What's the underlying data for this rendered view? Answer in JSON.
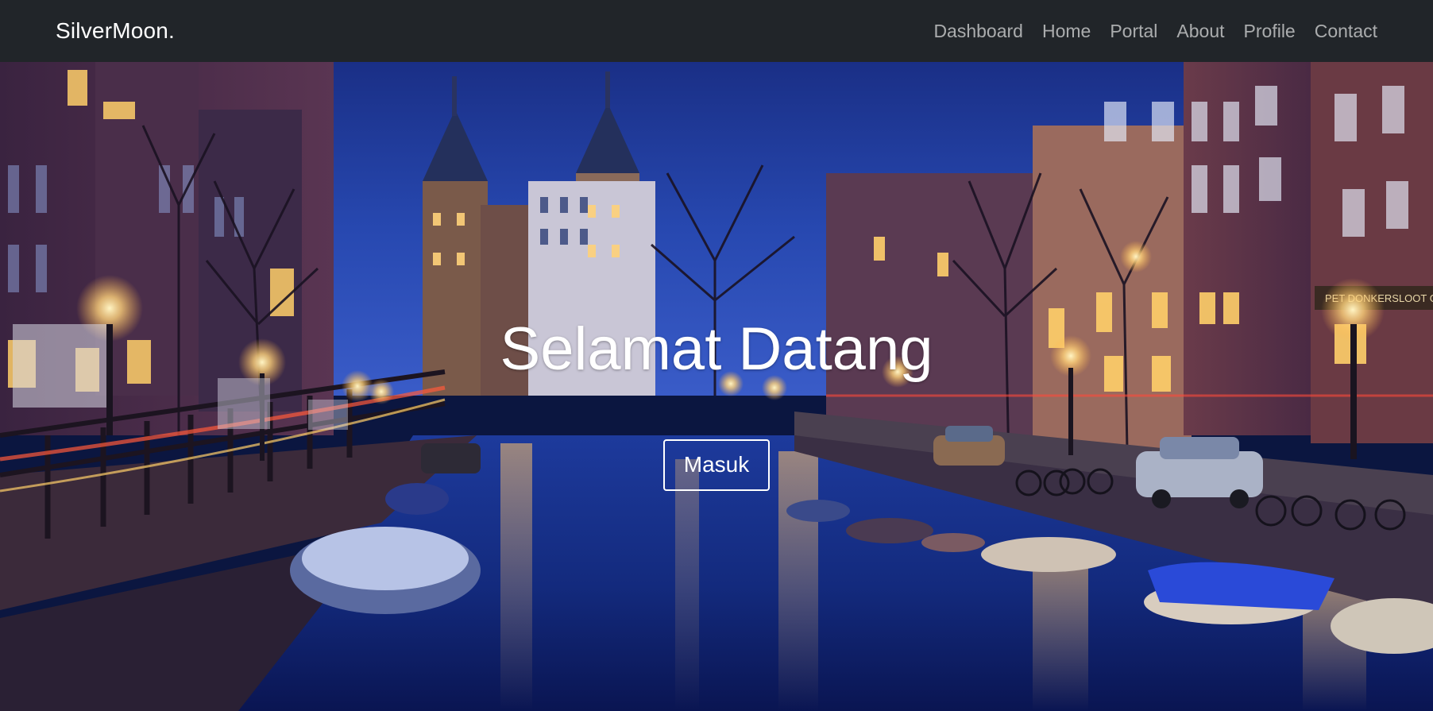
{
  "navbar": {
    "brand": "SilverMoon.",
    "links": [
      "Dashboard",
      "Home",
      "Portal",
      "About",
      "Profile",
      "Contact"
    ]
  },
  "hero": {
    "title": "Selamat Datang",
    "button_label": "Masuk",
    "background_description_icon": "canal-city-night-photo"
  },
  "colors": {
    "navbar_bg": "#212529",
    "brand": "#ffffff",
    "nav_link": "#9a9c9e",
    "sky": "#1b3a8f",
    "water": "#0c1b66",
    "lights": "#ffd27a"
  }
}
